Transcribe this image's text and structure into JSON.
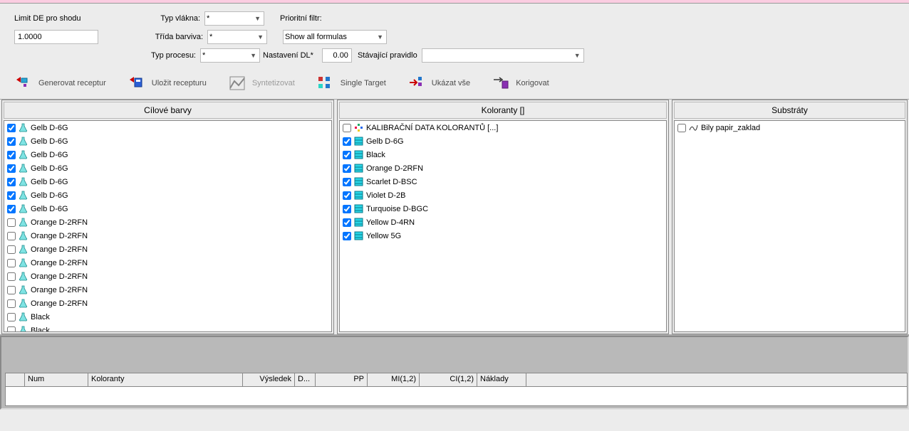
{
  "form": {
    "limit_label": "Limit DE pro shodu",
    "limit_value": "1.0000",
    "fiber_label": "Typ vlákna:",
    "fiber_value": "*",
    "class_label": "Třída barviva:",
    "class_value": "*",
    "process_label": "Typ procesu:",
    "process_value": "*",
    "priority_label": "Prioritní filtr:",
    "show_all": "Show all formulas",
    "dl_label": "Nastavení DL*",
    "dl_value": "0.00",
    "rule_label": "Stávající pravidlo"
  },
  "toolbar": {
    "generate": "Generovat receptur",
    "save": "Uložit recepturu",
    "synth": "Syntetizovat",
    "single": "Single Target",
    "showall": "Ukázat vše",
    "correct": "Korigovat"
  },
  "panels": {
    "targets_header": "Cílové barvy",
    "colorants_header": "Koloranty []",
    "substrates_header": "Substráty",
    "targets": [
      {
        "checked": true,
        "label": "Gelb D-6G"
      },
      {
        "checked": true,
        "label": "Gelb D-6G"
      },
      {
        "checked": true,
        "label": "Gelb D-6G"
      },
      {
        "checked": true,
        "label": "Gelb D-6G"
      },
      {
        "checked": true,
        "label": "Gelb D-6G"
      },
      {
        "checked": true,
        "label": "Gelb D-6G"
      },
      {
        "checked": true,
        "label": "Gelb D-6G"
      },
      {
        "checked": false,
        "label": "Orange D-2RFN"
      },
      {
        "checked": false,
        "label": "Orange D-2RFN"
      },
      {
        "checked": false,
        "label": "Orange D-2RFN"
      },
      {
        "checked": false,
        "label": "Orange D-2RFN"
      },
      {
        "checked": false,
        "label": "Orange D-2RFN"
      },
      {
        "checked": false,
        "label": "Orange D-2RFN"
      },
      {
        "checked": false,
        "label": "Orange D-2RFN"
      },
      {
        "checked": false,
        "label": "Black"
      },
      {
        "checked": false,
        "label": "Black"
      }
    ],
    "colorants_root": "KALIBRAČNÍ DATA KOLORANTŮ [...]",
    "colorants": [
      {
        "checked": true,
        "label": "Gelb D-6G"
      },
      {
        "checked": true,
        "label": "Black"
      },
      {
        "checked": true,
        "label": "Orange D-2RFN"
      },
      {
        "checked": true,
        "label": "Scarlet D-BSC"
      },
      {
        "checked": true,
        "label": "Violet D-2B"
      },
      {
        "checked": true,
        "label": "Turquoise D-BGC"
      },
      {
        "checked": true,
        "label": "Yellow D-4RN"
      },
      {
        "checked": true,
        "label": "Yellow 5G"
      }
    ],
    "substrates": [
      {
        "checked": false,
        "label": "Bily papir_zaklad"
      }
    ]
  },
  "grid": {
    "cols": [
      "Num",
      "Koloranty",
      "Výsledek",
      "D...",
      "PP",
      "MI(1,2)",
      "CI(1,2)",
      "Náklady"
    ]
  }
}
